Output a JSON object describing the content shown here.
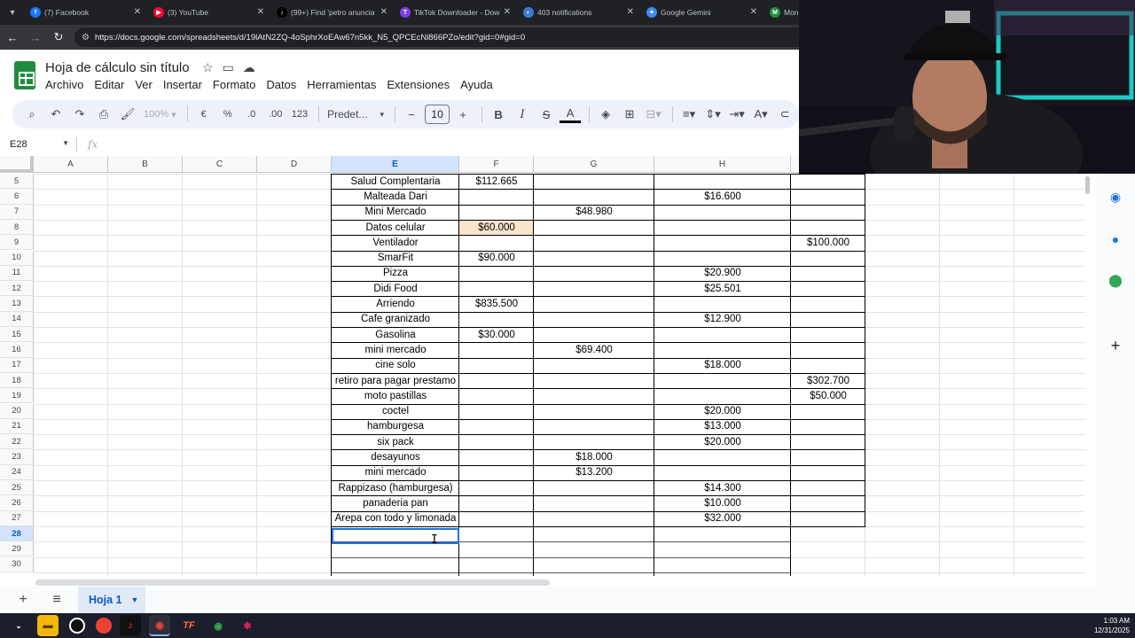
{
  "browser": {
    "tabs": [
      {
        "title": "(7) Facebook",
        "color": "#1877f2",
        "glyph": "f"
      },
      {
        "title": "(3) YouTube",
        "color": "#ff0033",
        "glyph": "▶"
      },
      {
        "title": "(99+) Find 'petro anuncia",
        "color": "#000000",
        "glyph": "♪"
      },
      {
        "title": "TikTok Downloader - Dow",
        "color": "#7b3fe4",
        "glyph": "T"
      },
      {
        "title": "403 notifications",
        "color": "#3a7bd5",
        "glyph": "◐"
      },
      {
        "title": "Google Gemini",
        "color": "#4285f4",
        "glyph": "✦"
      },
      {
        "title": "Monet",
        "color": "#1e8e3e",
        "glyph": "M"
      }
    ],
    "url": "https://docs.google.com/spreadsheets/d/19lAtN2ZQ-4oSphrXoEAw67n5kk_N5_QPCEcNi866PZo/edit?gid=0#gid=0"
  },
  "doc": {
    "title": "Hoja de cálculo sin título"
  },
  "menu": [
    "Archivo",
    "Editar",
    "Ver",
    "Insertar",
    "Formato",
    "Datos",
    "Herramientas",
    "Extensiones",
    "Ayuda"
  ],
  "toolbar": {
    "zoom": "100%",
    "currency": "€",
    "percent": "%",
    "dec_less": ".0",
    "dec_more": ".00",
    "number_format": "123",
    "font": "Predet...",
    "font_size": "10"
  },
  "formula_bar": {
    "cell_ref": "E28",
    "fx": "fx",
    "content": ""
  },
  "columns": [
    "A",
    "B",
    "C",
    "D",
    "E",
    "F",
    "G",
    "H",
    ""
  ],
  "selected_column": "E",
  "selected_row": "28",
  "rows": [
    {
      "n": "5",
      "E": "Salud Complentaria",
      "F": "$112.665",
      "G": "",
      "H": "",
      "I": ""
    },
    {
      "n": "6",
      "E": "Malteada Dari",
      "F": "",
      "G": "",
      "H": "$16.600",
      "I": ""
    },
    {
      "n": "7",
      "E": "Mini Mercado",
      "F": "",
      "G": "$48.980",
      "H": "",
      "I": ""
    },
    {
      "n": "8",
      "E": "Datos celular",
      "F": "$60.000",
      "G": "",
      "H": "",
      "I": "",
      "highlight": "F"
    },
    {
      "n": "9",
      "E": "Ventilador",
      "F": "",
      "G": "",
      "H": "",
      "I": "$100.000"
    },
    {
      "n": "10",
      "E": "SmarFit",
      "F": "$90.000",
      "G": "",
      "H": "",
      "I": ""
    },
    {
      "n": "11",
      "E": "Pizza",
      "F": "",
      "G": "",
      "H": "$20.900",
      "I": ""
    },
    {
      "n": "12",
      "E": "Didi Food",
      "F": "",
      "G": "",
      "H": "$25.501",
      "I": ""
    },
    {
      "n": "13",
      "E": "Arriendo",
      "F": "$835.500",
      "G": "",
      "H": "",
      "I": ""
    },
    {
      "n": "14",
      "E": "Cafe granizado",
      "F": "",
      "G": "",
      "H": "$12.900",
      "I": ""
    },
    {
      "n": "15",
      "E": "Gasolina",
      "F": "$30.000",
      "G": "",
      "H": "",
      "I": ""
    },
    {
      "n": "16",
      "E": "mini mercado",
      "F": "",
      "G": "$69.400",
      "H": "",
      "I": ""
    },
    {
      "n": "17",
      "E": "cine solo",
      "F": "",
      "G": "",
      "H": "$18.000",
      "I": ""
    },
    {
      "n": "18",
      "E": "retiro para pagar prestamo",
      "F": "",
      "G": "",
      "H": "",
      "I": "$302.700"
    },
    {
      "n": "19",
      "E": "moto pastillas",
      "F": "",
      "G": "",
      "H": "",
      "I": "$50.000"
    },
    {
      "n": "20",
      "E": "coctel",
      "F": "",
      "G": "",
      "H": "$20.000",
      "I": ""
    },
    {
      "n": "21",
      "E": "hamburgesa",
      "F": "",
      "G": "",
      "H": "$13.000",
      "I": ""
    },
    {
      "n": "22",
      "E": "six pack",
      "F": "",
      "G": "",
      "H": "$20.000",
      "I": ""
    },
    {
      "n": "23",
      "E": "desayunos",
      "F": "",
      "G": "$18.000",
      "H": "",
      "I": ""
    },
    {
      "n": "24",
      "E": "mini mercado",
      "F": "",
      "G": "$13.200",
      "H": "",
      "I": ""
    },
    {
      "n": "25",
      "E": "Rappizaso (hamburgesa)",
      "F": "",
      "G": "",
      "H": "$14.300",
      "I": ""
    },
    {
      "n": "26",
      "E": "panaderia pan",
      "F": "",
      "G": "",
      "H": "$10.000",
      "I": ""
    },
    {
      "n": "27",
      "E": "Arepa con todo y limonada",
      "F": "",
      "G": "",
      "H": "$32.000",
      "I": ""
    },
    {
      "n": "28",
      "E": "",
      "F": "",
      "G": "",
      "H": "",
      "I": ""
    },
    {
      "n": "29",
      "E": "",
      "F": "",
      "G": "",
      "H": "",
      "I": ""
    },
    {
      "n": "30",
      "E": "",
      "F": "",
      "G": "",
      "H": "",
      "I": ""
    }
  ],
  "sheets": {
    "active": "Hoja 1"
  },
  "taskbar": {
    "time": "1:03 AM",
    "date": "12/31/2025"
  },
  "colors": {
    "accent": "#0b57d0",
    "sheets_green": "#1e8e3e",
    "highlight_cell": "#fce5cd",
    "selection": "#1a73e8"
  }
}
